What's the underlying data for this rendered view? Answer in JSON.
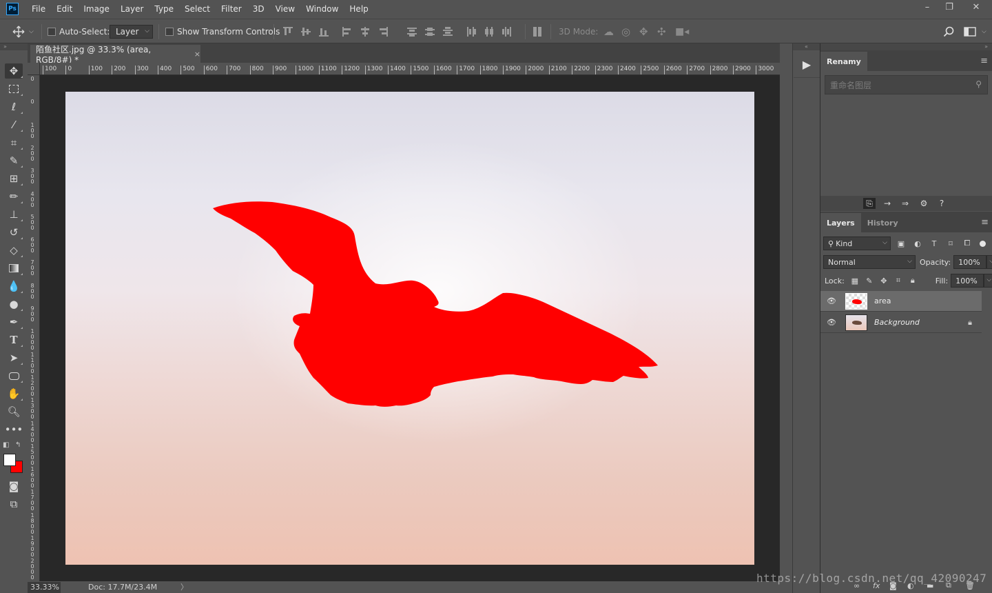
{
  "menubar": {
    "logo": "Ps",
    "items": [
      "File",
      "Edit",
      "Image",
      "Layer",
      "Type",
      "Select",
      "Filter",
      "3D",
      "View",
      "Window",
      "Help"
    ],
    "window_controls": [
      "–",
      "❐",
      "✕"
    ]
  },
  "options": {
    "auto_select_label": "Auto-Select:",
    "auto_select_checked": false,
    "auto_select_target": "Layer",
    "show_transform_label": "Show Transform Controls",
    "show_transform_checked": false,
    "mode_3d_label": "3D Mode:"
  },
  "document": {
    "tab_title": "陌鱼社区.jpg @ 33.3% (area, RGB/8#) *",
    "tab_close": "×",
    "ruler_h": [
      "100",
      "0",
      "100",
      "200",
      "300",
      "400",
      "500",
      "600",
      "700",
      "800",
      "900",
      "1000",
      "1100",
      "1200",
      "1300",
      "1400",
      "1500",
      "1600",
      "1700",
      "1800",
      "1900",
      "2000",
      "2100",
      "2200",
      "2300",
      "2400",
      "2500",
      "2600",
      "2700",
      "2800",
      "2900",
      "3000"
    ],
    "ruler_v": [
      "0",
      "0",
      "1\n0\n0",
      "2\n0\n0",
      "3\n0\n0",
      "4\n0\n0",
      "5\n0\n0",
      "6\n0\n0",
      "7\n0\n0",
      "8\n0\n0",
      "9\n0\n0",
      "1\n0\n0\n0",
      "1\n1\n0\n0",
      "1\n2\n0\n0",
      "1\n3\n0\n0",
      "1\n4\n0\n0",
      "1\n5\n0\n0",
      "1\n6\n0\n0",
      "1\n7\n0\n0",
      "1\n8\n0\n0",
      "1\n9\n0\n0",
      "2\n0\n0\n0"
    ],
    "silhouette_color": "#ff0000"
  },
  "status": {
    "zoom": "33.33%",
    "doc_info": "Doc: 17.7M/23.4M",
    "arrow": "〉"
  },
  "toolbar": {
    "tools": [
      "move-tool",
      "marquee-tool",
      "lasso-tool",
      "magic-wand-tool",
      "crop-tool",
      "eyedropper-tool",
      "healing-tool",
      "brush-tool",
      "stamp-tool",
      "history-brush-tool",
      "eraser-tool",
      "gradient-tool",
      "blur-tool",
      "dodge-tool",
      "pen-tool",
      "type-tool",
      "path-select-tool",
      "shape-tool",
      "hand-tool",
      "zoom-tool",
      "more-tools"
    ],
    "foreground_color": "#ffffff",
    "background_color": "#ff0000"
  },
  "renamy": {
    "tab": "Renamy",
    "search_placeholder": "重命名图层"
  },
  "layers": {
    "tabs": [
      "Layers",
      "History"
    ],
    "filter_kind": "Kind",
    "blend_mode": "Normal",
    "opacity_label": "Opacity:",
    "opacity_value": "100%",
    "lock_label": "Lock:",
    "fill_label": "Fill:",
    "fill_value": "100%",
    "items": [
      {
        "name": "area",
        "visible": true,
        "selected": true,
        "locked": false
      },
      {
        "name": "Background",
        "visible": true,
        "selected": false,
        "locked": true
      }
    ]
  },
  "watermark": "https://blog.csdn.net/qq_42090247"
}
